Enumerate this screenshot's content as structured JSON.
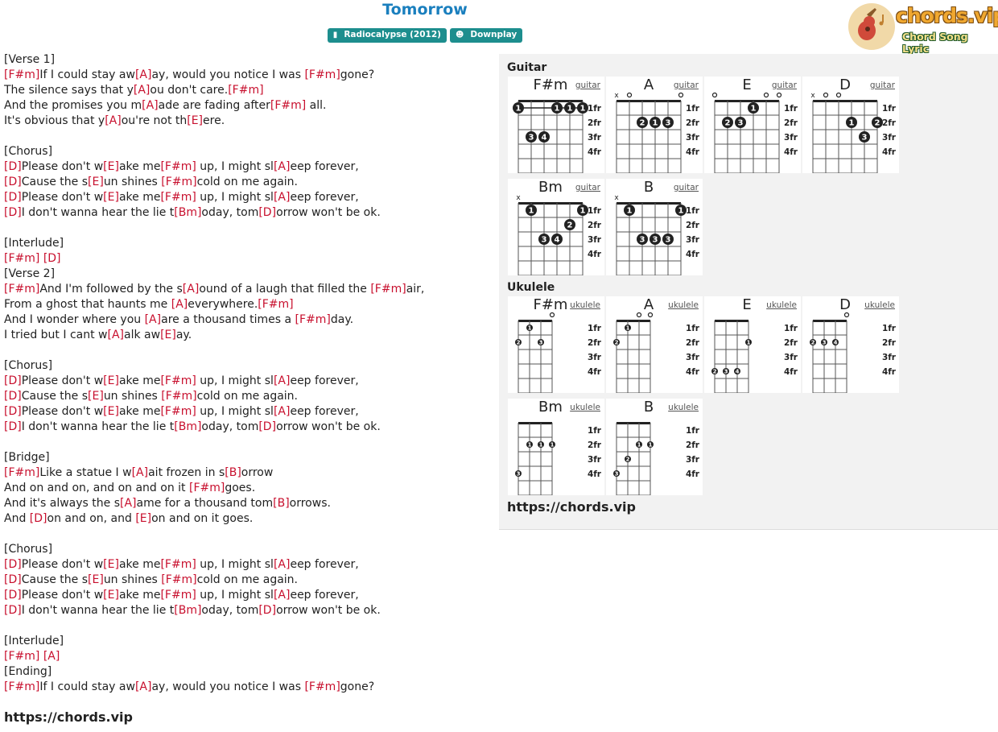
{
  "song": {
    "title": "Tomorrow",
    "album": "Radiocalypse (2012)",
    "album_icon": "book-icon",
    "artist": "Downplay",
    "artist_icon": "user-icon"
  },
  "logo": {
    "text": "chords.vip",
    "subtitle": "Chord Song Lyric"
  },
  "lyrics": [
    [
      {
        "t": "[Verse 1]"
      }
    ],
    [
      {
        "c": "[F#m]"
      },
      {
        "t": "If I could stay aw"
      },
      {
        "c": "[A]"
      },
      {
        "t": "ay, would you notice I was "
      },
      {
        "c": "[F#m]"
      },
      {
        "t": "gone?"
      }
    ],
    [
      {
        "t": "The silence says that y"
      },
      {
        "c": "[A]"
      },
      {
        "t": "ou don't care."
      },
      {
        "c": "[F#m]"
      }
    ],
    [
      {
        "t": "And the promises you m"
      },
      {
        "c": "[A]"
      },
      {
        "t": "ade are fading after"
      },
      {
        "c": "[F#m]"
      },
      {
        "t": " all."
      }
    ],
    [
      {
        "t": "It's obvious that y"
      },
      {
        "c": "[A]"
      },
      {
        "t": "ou're not th"
      },
      {
        "c": "[E]"
      },
      {
        "t": "ere."
      }
    ],
    [],
    [
      {
        "t": "[Chorus]"
      }
    ],
    [
      {
        "c": "[D]"
      },
      {
        "t": "Please don't w"
      },
      {
        "c": "[E]"
      },
      {
        "t": "ake me"
      },
      {
        "c": "[F#m]"
      },
      {
        "t": " up, I might sl"
      },
      {
        "c": "[A]"
      },
      {
        "t": "eep forever,"
      }
    ],
    [
      {
        "c": "[D]"
      },
      {
        "t": "Cause the s"
      },
      {
        "c": "[E]"
      },
      {
        "t": "un shines "
      },
      {
        "c": "[F#m]"
      },
      {
        "t": "cold on me again."
      }
    ],
    [
      {
        "c": "[D]"
      },
      {
        "t": "Please don't w"
      },
      {
        "c": "[E]"
      },
      {
        "t": "ake me"
      },
      {
        "c": "[F#m]"
      },
      {
        "t": " up, I might sl"
      },
      {
        "c": "[A]"
      },
      {
        "t": "eep forever,"
      }
    ],
    [
      {
        "c": "[D]"
      },
      {
        "t": "I don't wanna hear the lie t"
      },
      {
        "c": "[Bm]"
      },
      {
        "t": "oday, tom"
      },
      {
        "c": "[D]"
      },
      {
        "t": "orrow won't be ok."
      }
    ],
    [],
    [
      {
        "t": "[Interlude]"
      }
    ],
    [
      {
        "c": "[F#m]"
      },
      {
        "t": " "
      },
      {
        "c": "[D]"
      }
    ],
    [
      {
        "t": "[Verse 2]"
      }
    ],
    [
      {
        "c": "[F#m]"
      },
      {
        "t": "And I'm followed by the s"
      },
      {
        "c": "[A]"
      },
      {
        "t": "ound of a laugh that filled the "
      },
      {
        "c": "[F#m]"
      },
      {
        "t": "air,"
      }
    ],
    [
      {
        "t": "From a ghost that haunts me "
      },
      {
        "c": "[A]"
      },
      {
        "t": "everywhere."
      },
      {
        "c": "[F#m]"
      }
    ],
    [
      {
        "t": "And I wonder where you "
      },
      {
        "c": "[A]"
      },
      {
        "t": "are a thousand times a "
      },
      {
        "c": "[F#m]"
      },
      {
        "t": "day."
      }
    ],
    [
      {
        "t": "I tried but I cant w"
      },
      {
        "c": "[A]"
      },
      {
        "t": "alk aw"
      },
      {
        "c": "[E]"
      },
      {
        "t": "ay."
      }
    ],
    [],
    [
      {
        "t": "[Chorus]"
      }
    ],
    [
      {
        "c": "[D]"
      },
      {
        "t": "Please don't w"
      },
      {
        "c": "[E]"
      },
      {
        "t": "ake me"
      },
      {
        "c": "[F#m]"
      },
      {
        "t": " up, I might sl"
      },
      {
        "c": "[A]"
      },
      {
        "t": "eep forever,"
      }
    ],
    [
      {
        "c": "[D]"
      },
      {
        "t": "Cause the s"
      },
      {
        "c": "[E]"
      },
      {
        "t": "un shines "
      },
      {
        "c": "[F#m]"
      },
      {
        "t": "cold on me again."
      }
    ],
    [
      {
        "c": "[D]"
      },
      {
        "t": "Please don't w"
      },
      {
        "c": "[E]"
      },
      {
        "t": "ake me"
      },
      {
        "c": "[F#m]"
      },
      {
        "t": " up, I might sl"
      },
      {
        "c": "[A]"
      },
      {
        "t": "eep forever,"
      }
    ],
    [
      {
        "c": "[D]"
      },
      {
        "t": "I don't wanna hear the lie t"
      },
      {
        "c": "[Bm]"
      },
      {
        "t": "oday, tom"
      },
      {
        "c": "[D]"
      },
      {
        "t": "orrow won't be ok."
      }
    ],
    [],
    [
      {
        "t": "[Bridge]"
      }
    ],
    [
      {
        "c": "[F#m]"
      },
      {
        "t": "Like a statue I w"
      },
      {
        "c": "[A]"
      },
      {
        "t": "ait frozen in s"
      },
      {
        "c": "[B]"
      },
      {
        "t": "orrow"
      }
    ],
    [
      {
        "t": "And on and on, and on and on it "
      },
      {
        "c": "[F#m]"
      },
      {
        "t": "goes."
      }
    ],
    [
      {
        "t": "And it's always the s"
      },
      {
        "c": "[A]"
      },
      {
        "t": "ame for a thousand tom"
      },
      {
        "c": "[B]"
      },
      {
        "t": "orrows."
      }
    ],
    [
      {
        "t": "And "
      },
      {
        "c": "[D]"
      },
      {
        "t": "on and on, and "
      },
      {
        "c": "[E]"
      },
      {
        "t": "on and on it goes."
      }
    ],
    [],
    [
      {
        "t": "[Chorus]"
      }
    ],
    [
      {
        "c": "[D]"
      },
      {
        "t": "Please don't w"
      },
      {
        "c": "[E]"
      },
      {
        "t": "ake me"
      },
      {
        "c": "[F#m]"
      },
      {
        "t": " up, I might sl"
      },
      {
        "c": "[A]"
      },
      {
        "t": "eep forever,"
      }
    ],
    [
      {
        "c": "[D]"
      },
      {
        "t": "Cause the s"
      },
      {
        "c": "[E]"
      },
      {
        "t": "un shines "
      },
      {
        "c": "[F#m]"
      },
      {
        "t": "cold on me again."
      }
    ],
    [
      {
        "c": "[D]"
      },
      {
        "t": "Please don't w"
      },
      {
        "c": "[E]"
      },
      {
        "t": "ake me"
      },
      {
        "c": "[F#m]"
      },
      {
        "t": " up, I might sl"
      },
      {
        "c": "[A]"
      },
      {
        "t": "eep forever,"
      }
    ],
    [
      {
        "c": "[D]"
      },
      {
        "t": "I don't wanna hear the lie t"
      },
      {
        "c": "[Bm]"
      },
      {
        "t": "oday, tom"
      },
      {
        "c": "[D]"
      },
      {
        "t": "orrow won't be ok."
      }
    ],
    [],
    [
      {
        "t": "[Interlude]"
      }
    ],
    [
      {
        "c": "[F#m]"
      },
      {
        "t": " "
      },
      {
        "c": "[A]"
      }
    ],
    [
      {
        "t": "[Ending]"
      }
    ],
    [
      {
        "c": "[F#m]"
      },
      {
        "t": "If I could stay aw"
      },
      {
        "c": "[A]"
      },
      {
        "t": "ay, would you notice I was "
      },
      {
        "c": "[F#m]"
      },
      {
        "t": "gone?"
      }
    ]
  ],
  "footer_url": "https://chords.vip",
  "fret_labels": [
    "1fr",
    "2fr",
    "3fr",
    "4fr"
  ],
  "guitar": {
    "label": "Guitar",
    "chords": [
      {
        "name": "F#m",
        "type": "guitar",
        "barre": {
          "fret": 1,
          "from": 1,
          "to": 6,
          "finger": "1"
        },
        "marks": [],
        "dots": [
          {
            "s": 1,
            "f": 1,
            "n": "1"
          },
          {
            "s": 4,
            "f": 1,
            "n": "1"
          },
          {
            "s": 5,
            "f": 1,
            "n": "1"
          },
          {
            "s": 6,
            "f": 1,
            "n": "1"
          },
          {
            "s": 2,
            "f": 3,
            "n": "3"
          },
          {
            "s": 3,
            "f": 3,
            "n": "4"
          }
        ]
      },
      {
        "name": "A",
        "type": "guitar",
        "marks": [
          {
            "s": 1,
            "m": "x"
          },
          {
            "s": 2,
            "m": "o"
          },
          {
            "s": 6,
            "m": "o"
          }
        ],
        "dots": [
          {
            "s": 3,
            "f": 2,
            "n": "2"
          },
          {
            "s": 4,
            "f": 2,
            "n": "1"
          },
          {
            "s": 5,
            "f": 2,
            "n": "3"
          }
        ]
      },
      {
        "name": "E",
        "type": "guitar",
        "marks": [
          {
            "s": 1,
            "m": "o"
          },
          {
            "s": 5,
            "m": "o"
          },
          {
            "s": 6,
            "m": "o"
          }
        ],
        "dots": [
          {
            "s": 2,
            "f": 2,
            "n": "2"
          },
          {
            "s": 3,
            "f": 2,
            "n": "3"
          },
          {
            "s": 4,
            "f": 1,
            "n": "1"
          }
        ]
      },
      {
        "name": "D",
        "type": "guitar",
        "marks": [
          {
            "s": 1,
            "m": "x"
          },
          {
            "s": 2,
            "m": "o"
          },
          {
            "s": 3,
            "m": "o"
          }
        ],
        "dots": [
          {
            "s": 4,
            "f": 2,
            "n": "1"
          },
          {
            "s": 5,
            "f": 3,
            "n": "3"
          },
          {
            "s": 6,
            "f": 2,
            "n": "2"
          }
        ]
      },
      {
        "name": "Bm",
        "type": "guitar",
        "marks": [
          {
            "s": 1,
            "m": "x"
          }
        ],
        "dots": [
          {
            "s": 2,
            "f": 1,
            "n": "1"
          },
          {
            "s": 6,
            "f": 1,
            "n": "1"
          },
          {
            "s": 5,
            "f": 2,
            "n": "2"
          },
          {
            "s": 3,
            "f": 3,
            "n": "3"
          },
          {
            "s": 4,
            "f": 3,
            "n": "4"
          }
        ]
      },
      {
        "name": "B",
        "type": "guitar",
        "marks": [
          {
            "s": 1,
            "m": "x"
          }
        ],
        "dots": [
          {
            "s": 2,
            "f": 1,
            "n": "1"
          },
          {
            "s": 6,
            "f": 1,
            "n": "1"
          },
          {
            "s": 3,
            "f": 3,
            "n": "3"
          },
          {
            "s": 4,
            "f": 3,
            "n": "3"
          },
          {
            "s": 5,
            "f": 3,
            "n": "3"
          }
        ]
      }
    ]
  },
  "ukulele": {
    "label": "Ukulele",
    "chords": [
      {
        "name": "F#m",
        "type": "ukulele",
        "marks": [
          {
            "s": 4,
            "m": "o"
          }
        ],
        "dots": [
          {
            "s": 2,
            "f": 1,
            "n": "1"
          },
          {
            "s": 1,
            "f": 2,
            "n": "2"
          },
          {
            "s": 3,
            "f": 2,
            "n": "3"
          }
        ]
      },
      {
        "name": "A",
        "type": "ukulele",
        "marks": [
          {
            "s": 3,
            "m": "o"
          },
          {
            "s": 4,
            "m": "o"
          }
        ],
        "dots": [
          {
            "s": 2,
            "f": 1,
            "n": "1"
          },
          {
            "s": 1,
            "f": 2,
            "n": "2"
          }
        ]
      },
      {
        "name": "E",
        "type": "ukulele",
        "marks": [],
        "dots": [
          {
            "s": 4,
            "f": 2,
            "n": "1"
          },
          {
            "s": 1,
            "f": 4,
            "n": "2"
          },
          {
            "s": 2,
            "f": 4,
            "n": "3"
          },
          {
            "s": 3,
            "f": 4,
            "n": "4"
          }
        ]
      },
      {
        "name": "D",
        "type": "ukulele",
        "marks": [
          {
            "s": 4,
            "m": "o"
          }
        ],
        "dots": [
          {
            "s": 1,
            "f": 2,
            "n": "2"
          },
          {
            "s": 2,
            "f": 2,
            "n": "3"
          },
          {
            "s": 3,
            "f": 2,
            "n": "4"
          }
        ]
      },
      {
        "name": "Bm",
        "type": "ukulele",
        "marks": [],
        "dots": [
          {
            "s": 2,
            "f": 2,
            "n": "1"
          },
          {
            "s": 3,
            "f": 2,
            "n": "1"
          },
          {
            "s": 4,
            "f": 2,
            "n": "1"
          },
          {
            "s": 1,
            "f": 4,
            "n": "3"
          }
        ]
      },
      {
        "name": "B",
        "type": "ukulele",
        "marks": [],
        "dots": [
          {
            "s": 3,
            "f": 2,
            "n": "1"
          },
          {
            "s": 4,
            "f": 2,
            "n": "1"
          },
          {
            "s": 2,
            "f": 3,
            "n": "2"
          },
          {
            "s": 1,
            "f": 4,
            "n": "3"
          }
        ]
      }
    ]
  },
  "panel_url": "https://chords.vip",
  "colors": {
    "title": "#1a7fbe",
    "chord": "#c8102e",
    "badge": "#1d8e8e",
    "panel_bg": "#f2f2f2"
  }
}
